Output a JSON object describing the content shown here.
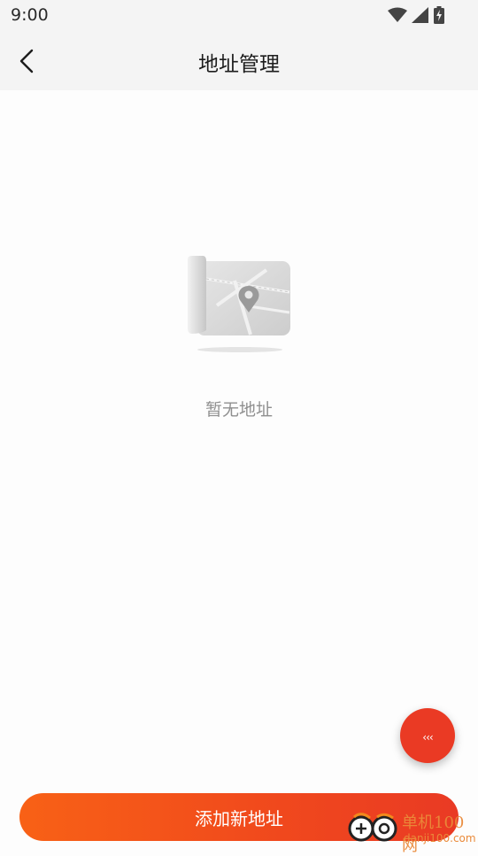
{
  "status_bar": {
    "time": "9:00",
    "icons": [
      "wifi-icon",
      "signal-icon",
      "battery-icon"
    ]
  },
  "header": {
    "back_icon": "chevron-left-icon",
    "title": "地址管理"
  },
  "empty_state": {
    "illustration": "map-pin-icon",
    "message": "暂无地址"
  },
  "fab": {
    "icon": "chat-bubble-icon",
    "glyph": "‹‹‹"
  },
  "footer": {
    "add_button_label": "添加新地址"
  },
  "watermark": {
    "title": "单机100网",
    "subtitle": "danji100.com"
  },
  "colors": {
    "accent_start": "#f86116",
    "accent_end": "#e93a24",
    "bar_background": "#f4f4f4",
    "empty_text": "#8f8f8f"
  }
}
